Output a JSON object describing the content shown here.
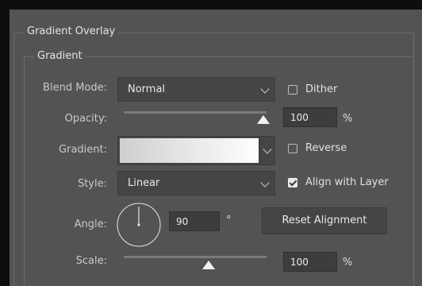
{
  "section": {
    "title": "Gradient Overlay",
    "subtitle": "Gradient"
  },
  "blend_mode": {
    "label": "Blend Mode:",
    "value": "Normal"
  },
  "dither": {
    "label": "Dither",
    "checked": false
  },
  "opacity": {
    "label": "Opacity:",
    "value": "100",
    "unit": "%",
    "level": 1.0
  },
  "gradient": {
    "label": "Gradient:",
    "from_color": "#cfcfcf",
    "to_color": "#ffffff"
  },
  "reverse": {
    "label": "Reverse",
    "checked": false
  },
  "style": {
    "label": "Style:",
    "value": "Linear"
  },
  "align_with_layer": {
    "label": "Align with Layer",
    "checked": true
  },
  "angle": {
    "label": "Angle:",
    "value": "90",
    "unit": "°"
  },
  "reset_alignment": {
    "label": "Reset Alignment"
  },
  "scale": {
    "label": "Scale:",
    "value": "100",
    "unit": "%",
    "level": 0.6
  },
  "colors": {
    "panel_bg": "#535353",
    "field_bg": "#454545",
    "outer_bg": "#0e0e0e"
  }
}
